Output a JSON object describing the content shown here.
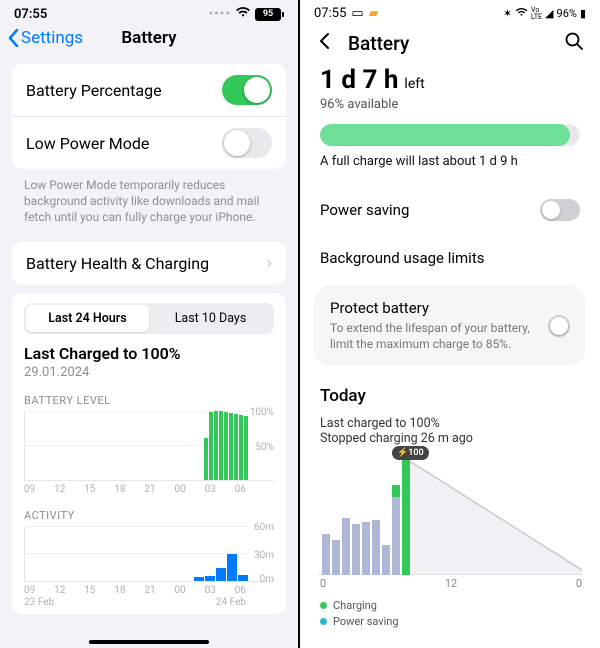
{
  "ios": {
    "status": {
      "time": "07:55",
      "battery": "95"
    },
    "nav": {
      "back": "Settings",
      "title": "Battery"
    },
    "rows": {
      "battery_percentage": "Battery Percentage",
      "low_power_mode": "Low Power Mode",
      "footnote": "Low Power Mode temporarily reduces background activity like downloads and mail fetch until you can fully charge your iPhone.",
      "health": "Battery Health & Charging"
    },
    "segmented": {
      "last24": "Last 24 Hours",
      "last10": "Last 10 Days"
    },
    "last_charged": {
      "title": "Last Charged to 100%",
      "date": "29.01.2024"
    },
    "battery_level_label": "BATTERY LEVEL",
    "activity_label": "ACTIVITY",
    "x_hours": [
      "09",
      "12",
      "15",
      "18",
      "21",
      "00",
      "03",
      "06"
    ],
    "x_dates": [
      "23 Feb",
      "24 Feb"
    ],
    "bl_right_ticks": [
      "100%",
      "50%"
    ],
    "act_right_ticks": [
      "60m",
      "30m",
      "0m"
    ]
  },
  "android": {
    "status": {
      "time": "07:55",
      "battery_pct": "96%"
    },
    "title": "Battery",
    "hero": {
      "big": "1 d 7 h",
      "suffix": "left",
      "avail": "96% available",
      "bar_pct": 96,
      "note": "A full charge will last about 1 d 9 h"
    },
    "rows": {
      "power_saving": "Power saving",
      "bg_limits": "Background usage limits"
    },
    "protect": {
      "title": "Protect battery",
      "sub": "To extend the lifespan of your battery, limit the maximum charge to 85%."
    },
    "today": {
      "h": "Today",
      "l1": "Last charged to 100%",
      "l2": "Stopped charging 26 m ago",
      "callout": "⚡100"
    },
    "x_ticks": [
      "0",
      "12",
      "0"
    ],
    "legend": {
      "charging": "Charging",
      "power_saving": "Power saving"
    }
  },
  "chart_data": [
    {
      "type": "bar",
      "title": "BATTERY LEVEL",
      "categories": [
        "09",
        "12",
        "15",
        "18",
        "21",
        "00",
        "03",
        "06"
      ],
      "ylim": [
        0,
        100
      ],
      "series": [
        {
          "name": "level",
          "values_at_06": [
            60,
            98,
            100,
            100,
            98,
            96,
            95,
            94,
            92
          ]
        }
      ],
      "note": "Only the trailing ~9 thin bars near 06:00 are visible; earlier hours show no bars."
    },
    {
      "type": "bar",
      "title": "ACTIVITY",
      "categories": [
        "09",
        "12",
        "15",
        "18",
        "21",
        "00",
        "03",
        "06"
      ],
      "ylabel": "minutes",
      "ylim": [
        0,
        60
      ],
      "values": [
        0,
        0,
        0,
        0,
        0,
        0,
        0,
        0,
        0,
        0,
        0,
        0,
        0,
        0,
        0,
        0,
        0,
        0,
        0,
        3,
        4,
        12,
        28,
        5
      ]
    },
    {
      "type": "bar",
      "title": "Today (Android battery)",
      "x": [
        0,
        1,
        2,
        3,
        4,
        5,
        6,
        7,
        8
      ],
      "series": [
        {
          "name": "Power saving / background",
          "color": "#aeb8d6",
          "values": [
            36,
            30,
            50,
            44,
            46,
            48,
            26,
            68,
            0
          ]
        },
        {
          "name": "Charging",
          "color": "#34c759",
          "values": [
            0,
            0,
            0,
            0,
            0,
            0,
            0,
            76,
            100
          ]
        }
      ],
      "projection_line_to_x": 24,
      "callout": {
        "x": 8,
        "label": "⚡100"
      }
    }
  ]
}
